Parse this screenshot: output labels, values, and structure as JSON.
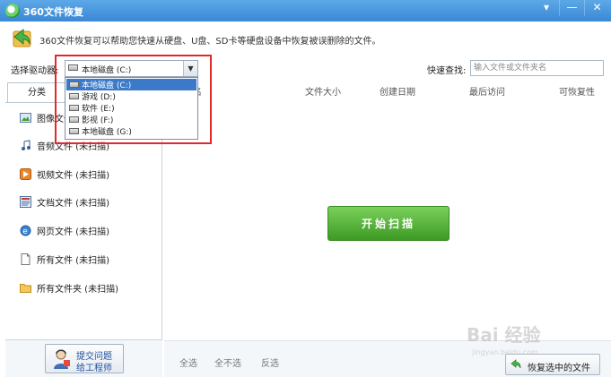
{
  "window": {
    "title": "360文件恢复",
    "controls": [
      "▾",
      "—",
      "✕"
    ]
  },
  "info": {
    "description": "360文件恢复可以帮助您快速从硬盘、U盘、SD卡等硬盘设备中恢复被误删除的文件。"
  },
  "toolbar": {
    "drive_label": "选择驱动器:",
    "drive_selected": "本地磁盘 (C:)",
    "quick_search_label": "快速查找:",
    "quick_search_placeholder": "输入文件或文件夹名"
  },
  "dropdown": {
    "options": [
      "本地磁盘 (C:)",
      "游戏 (D:)",
      "软件 (E:)",
      "影视 (F:)",
      "本地磁盘 (G:)"
    ],
    "selected_index": 0
  },
  "sidebar": {
    "tab_label": "分类",
    "categories": [
      {
        "label": "图像文件 (未扫描)",
        "icon": "image-icon"
      },
      {
        "label": "音频文件 (未扫描)",
        "icon": "music-icon"
      },
      {
        "label": "视频文件 (未扫描)",
        "icon": "video-icon"
      },
      {
        "label": "文档文件 (未扫描)",
        "icon": "document-icon"
      },
      {
        "label": "网页文件 (未扫描)",
        "icon": "webpage-icon"
      },
      {
        "label": "所有文件 (未扫描)",
        "icon": "file-icon"
      },
      {
        "label": "所有文件夹 (未扫描)",
        "icon": "folder-icon"
      }
    ],
    "support_button": {
      "line1": "提交问题",
      "line2": "给工程师"
    }
  },
  "table": {
    "columns": [
      "文件大小",
      "创建日期",
      "最后访问",
      "可恢复性"
    ],
    "hidden_first_column": "名"
  },
  "main": {
    "scan_button": "开始扫描"
  },
  "bottom": {
    "select_all": "全选",
    "select_none": "全不选",
    "invert": "反选",
    "restore_button": "恢复选中的文件"
  },
  "watermark": {
    "text": "Bai 经验",
    "url": "jingyan.baidu.com"
  },
  "colors": {
    "titlebar": "#3a88d6",
    "scan_button": "#4fae33",
    "highlight_box": "#e02a2a",
    "dropdown_selected": "#3c79c8"
  }
}
